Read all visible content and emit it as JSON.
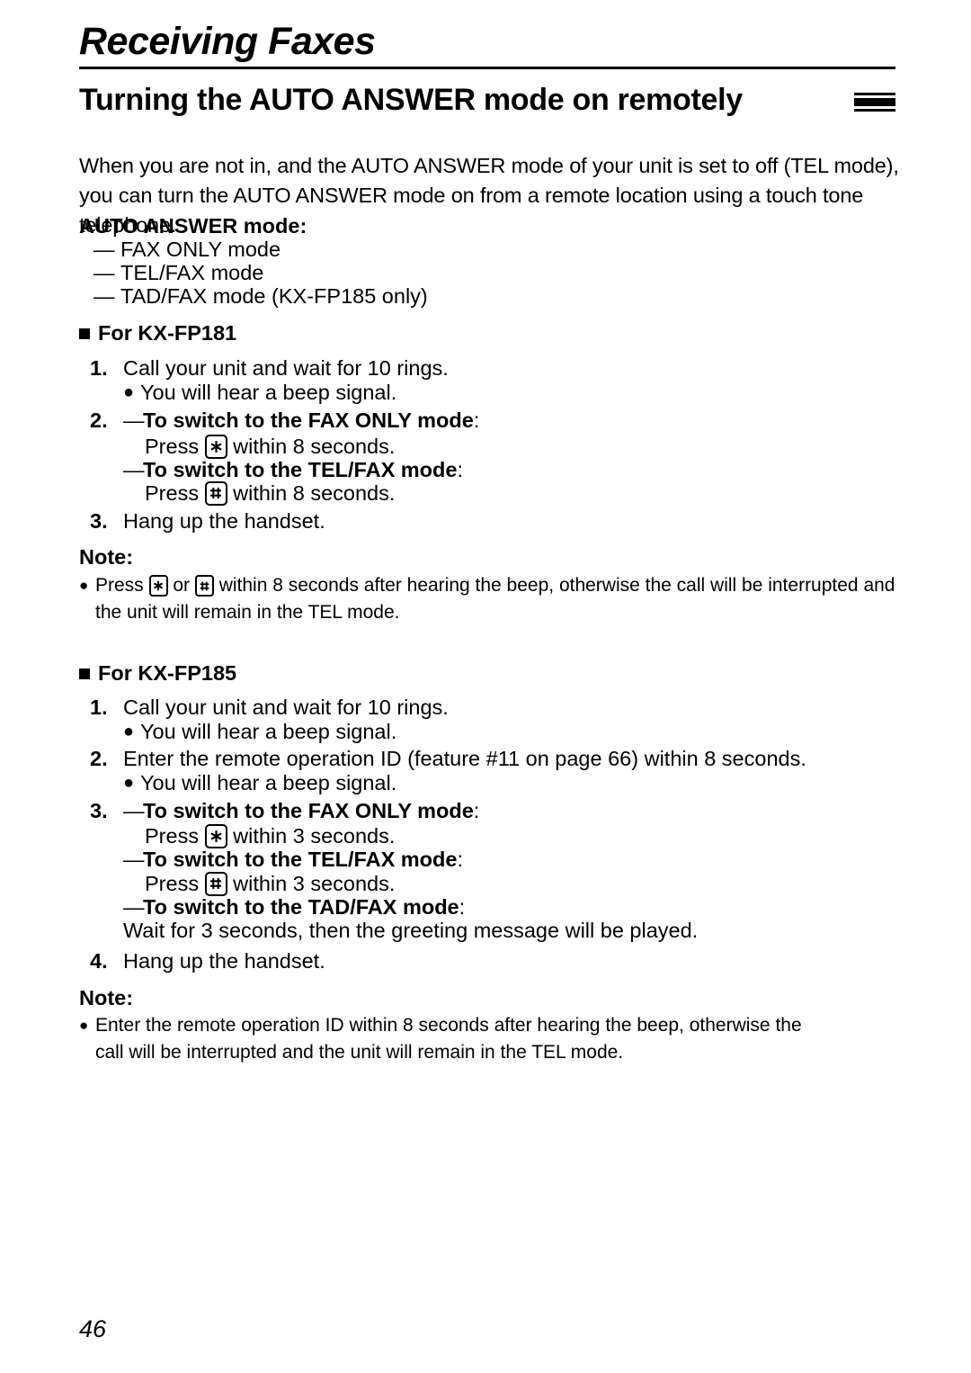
{
  "document": {
    "chapter_title": "Receiving Faxes",
    "section_heading": "Turning the AUTO ANSWER mode on remotely",
    "page_number": "46"
  },
  "intro": {
    "paragraph": "When you are not in, and the AUTO ANSWER mode of your unit is set to off (TEL mode), you can turn the AUTO ANSWER mode on from a remote location using a touch tone telephone."
  },
  "auto_answer": {
    "label": "AUTO ANSWER mode:",
    "dash": "—",
    "modes": [
      "FAX ONLY mode",
      "TEL/FAX mode",
      "TAD/FAX mode (KX-FP185 only)"
    ]
  },
  "fp181": {
    "heading": "For KX-FP181",
    "step1": {
      "number": "1.",
      "text": "Call your unit and wait for 10 rings.",
      "bullet": "●",
      "sub": "You will hear a beep signal."
    },
    "step2": {
      "number": "2.",
      "emdash": "—",
      "fax_only_label": "To switch to the FAX ONLY mode",
      "colon": ":",
      "fax_only_press_pre": "Press ",
      "fax_only_key": "asterisk-key",
      "fax_only_press_post": " within 8 seconds.",
      "tel_fax_label": "To switch to the TEL/FAX mode",
      "tel_fax_press_pre": "Press ",
      "tel_fax_key": "pound-key",
      "tel_fax_press_post": " within 8 seconds."
    },
    "step3": {
      "number": "3.",
      "text": "Hang up the handset."
    },
    "note": {
      "title": "Note:",
      "bullet": "●",
      "text_part1": "Press ",
      "key1": "asterisk-key",
      "text_part2": " or ",
      "key2": "pound-key",
      "text_part3": " within 8 seconds after hearing the beep, otherwise the call will be interrupted and the unit will remain in the TEL mode."
    }
  },
  "fp185": {
    "heading": "For KX-FP185",
    "step1": {
      "number": "1.",
      "text": "Call your unit and wait for 10 rings.",
      "bullet": "●",
      "sub": "You will hear a beep signal."
    },
    "step2": {
      "number": "2.",
      "text": "Enter the remote operation ID (feature #11 on page 66) within 8 seconds.",
      "bullet": "●",
      "sub": "You will hear a beep signal."
    },
    "step3": {
      "number": "3.",
      "emdash": "—",
      "colon": ":",
      "fax_only_label": "To switch to the FAX ONLY mode",
      "fax_only_press_pre": "Press ",
      "fax_only_key": "asterisk-key",
      "fax_only_press_post": " within 3 seconds.",
      "tel_fax_label": "To switch to the TEL/FAX mode",
      "tel_fax_press_pre": "Press ",
      "tel_fax_key": "pound-key",
      "tel_fax_press_post": " within 3 seconds.",
      "tad_fax_label": "To switch to the TAD/FAX mode",
      "tad_fax_text": "Wait for 3 seconds, then the greeting message will be played."
    },
    "step4": {
      "number": "4.",
      "text": "Hang up the handset."
    },
    "note": {
      "title": "Note:",
      "bullet": "●",
      "text": "Enter the remote operation ID within 8 seconds after hearing the beep, otherwise the call will be interrupted and the unit will remain in the TEL mode."
    }
  },
  "colors": {
    "ink": "#000000",
    "paper": "#ffffff"
  }
}
